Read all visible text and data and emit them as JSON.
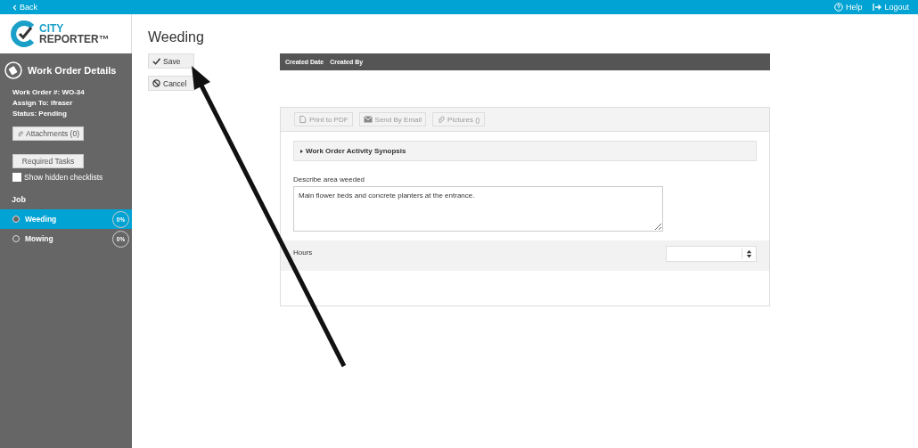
{
  "top_bar": {
    "back": "Back",
    "help": "Help",
    "logout": "Logout"
  },
  "logo": {
    "line1": "CITY",
    "line2": "REPORTER",
    "tm": "™"
  },
  "sidebar": {
    "title": "Work Order Details",
    "details": [
      "Work Order #: WO-34",
      "Assign To: ifraser",
      "Status: Pending"
    ],
    "attachments_button": "Attachments (0)",
    "required_tasks_button": "Required Tasks",
    "show_hidden": {
      "label": "Show hidden checklists",
      "checked": false
    },
    "section": "Job",
    "jobs": [
      {
        "label": "Weeding",
        "selected": true,
        "progress": "0%"
      },
      {
        "label": "Mowing",
        "selected": false,
        "progress": "0%"
      }
    ]
  },
  "page": {
    "title": "Weeding",
    "buttons": [
      {
        "kind": "save",
        "label": "Save"
      },
      {
        "kind": "cancel",
        "label": "Cancel"
      }
    ],
    "table": {
      "columns": [
        "Created Date",
        "Created By"
      ]
    },
    "toolbar": [
      {
        "kind": "pdf",
        "label": "Print to PDF"
      },
      {
        "kind": "email",
        "label": "Send By Email"
      },
      {
        "kind": "attach",
        "label": "Pictures ()"
      }
    ],
    "synopsis": {
      "label": "Work Order Activity Synopsis",
      "expanded": false
    },
    "describe": {
      "label": "Describe area weeded",
      "value": "Main flower beds and concrete planters at the entrance."
    },
    "hours": {
      "label": "Hours"
    }
  }
}
